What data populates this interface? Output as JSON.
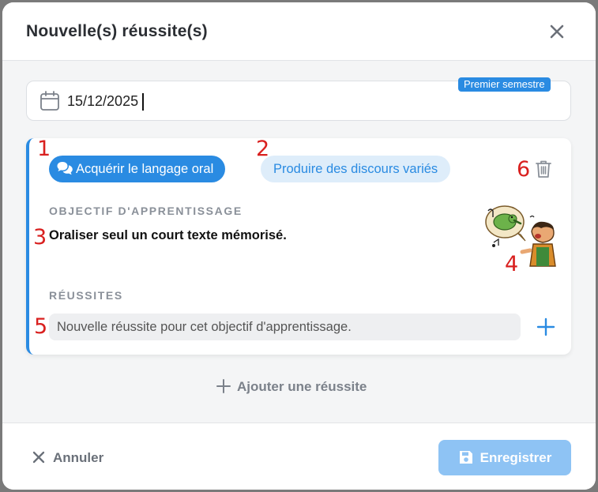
{
  "modal": {
    "title": "Nouvelle(s) réussite(s)"
  },
  "date": {
    "value": "15/12/2025",
    "semester_badge": "Premier semestre"
  },
  "card": {
    "tags": [
      {
        "label": "Acquérir le langage oral",
        "active": true
      },
      {
        "label": "Produire des discours variés",
        "active": false
      }
    ],
    "objective_label": "OBJECTIF D'APPRENTISSAGE",
    "objective_text": "Oraliser seul un court texte mémorisé.",
    "successes_label": "RÉUSSITES",
    "success_placeholder": "Nouvelle réussite pour cet objectif d'apprentissage.",
    "annotations": [
      "1",
      "2",
      "3",
      "4",
      "5",
      "6"
    ]
  },
  "add_success_label": "Ajouter une réussite",
  "footer": {
    "cancel_label": "Annuler",
    "save_label": "Enregistrer"
  },
  "colors": {
    "accent": "#2a8be2",
    "accent_light": "#deedfa",
    "save_disabled": "#8ec3f4",
    "annotation": "#d9201f"
  },
  "icons": [
    "close-icon",
    "calendar-icon",
    "chat-bubbles-icon",
    "trash-icon",
    "plus-icon",
    "save-icon"
  ]
}
